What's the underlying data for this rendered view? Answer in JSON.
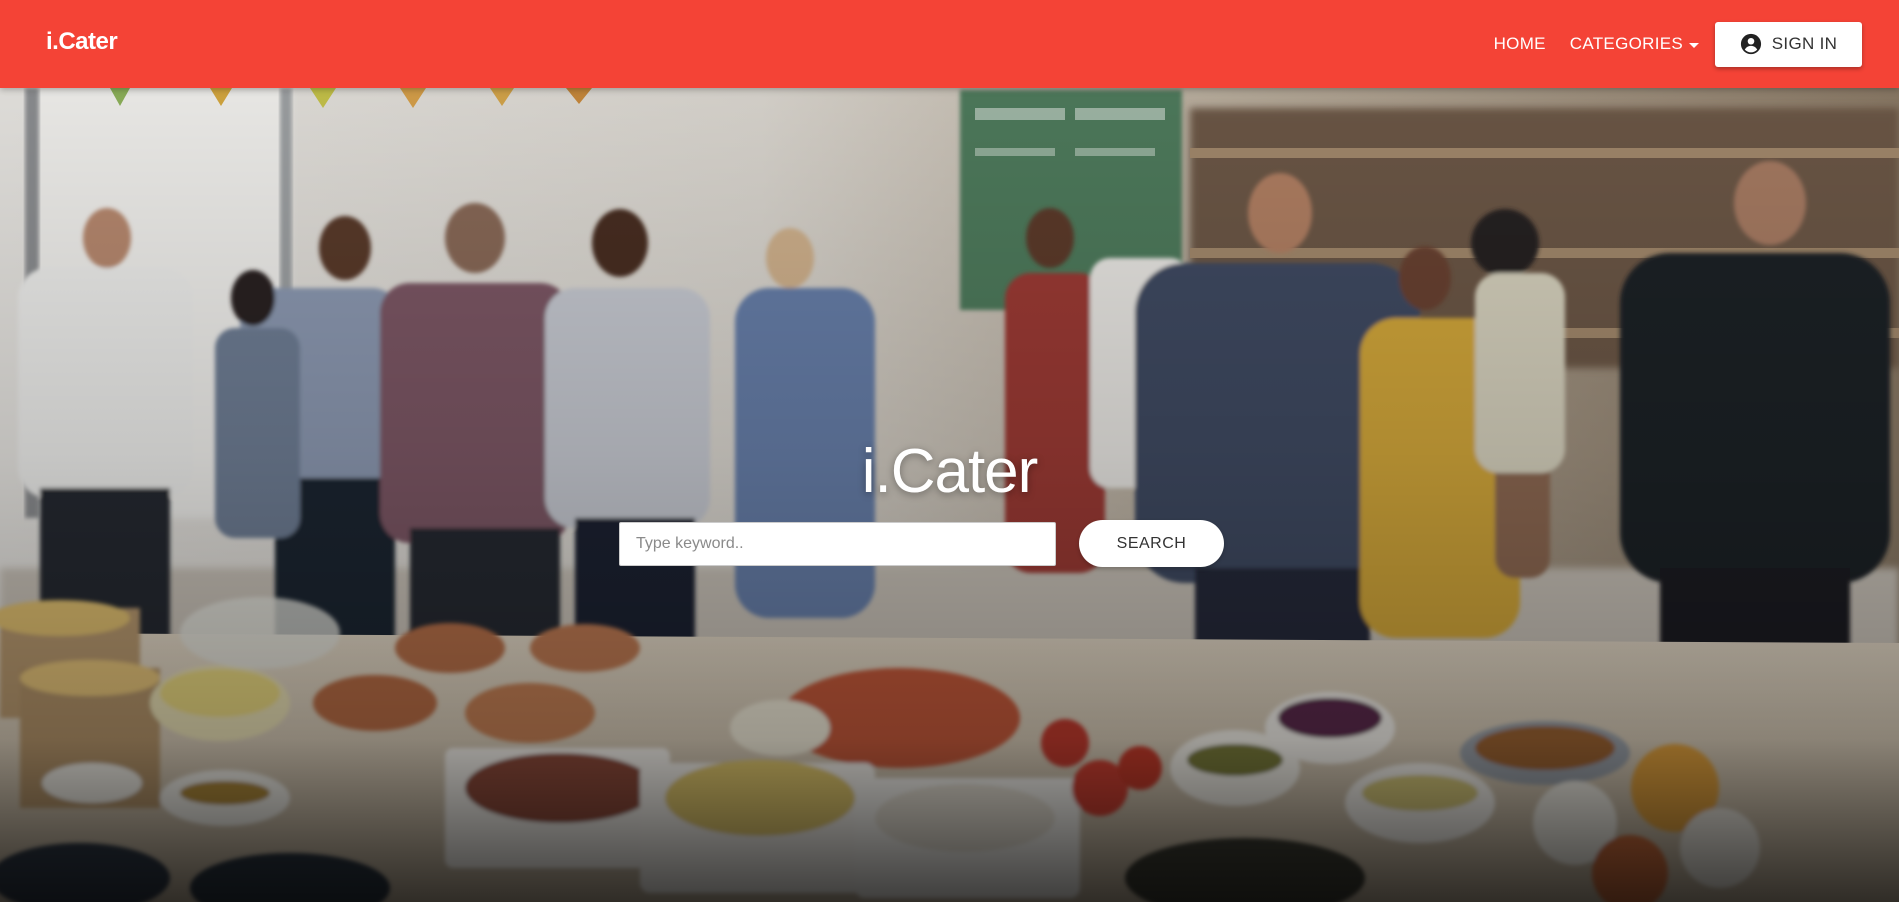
{
  "navbar": {
    "brand": "i.Cater",
    "home_label": "HOME",
    "categories_label": "CATEGORIES",
    "signin_label": "SIGN IN",
    "signin_icon": "account-circle-icon",
    "background_color": "#f44336"
  },
  "hero": {
    "title": "i.Cater",
    "search": {
      "placeholder": "Type keyword..",
      "value": "",
      "button_label": "SEARCH"
    }
  }
}
